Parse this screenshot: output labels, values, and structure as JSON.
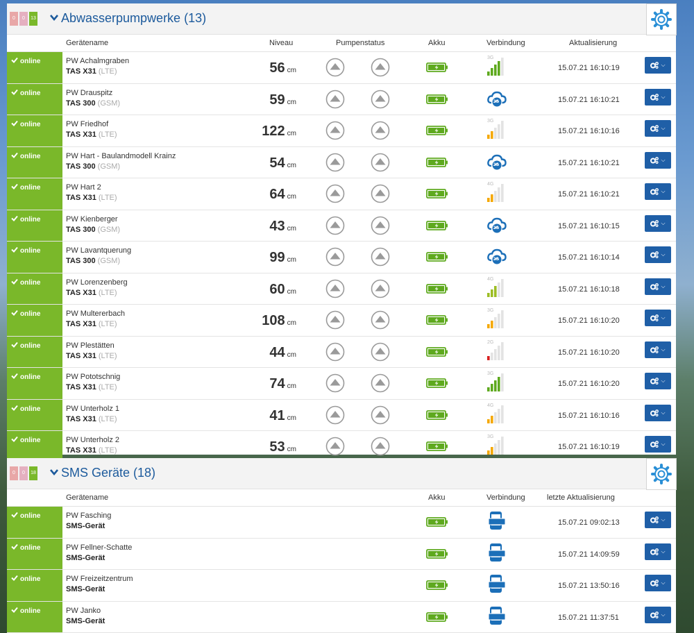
{
  "colors": {
    "online": "#7ab82a",
    "accent": "#1c5a9c",
    "button": "#1f5fa7",
    "gear": "#2a8fd6"
  },
  "panel1": {
    "badges": [
      "0",
      "0",
      "13"
    ],
    "title": "Abwasserpumpwerke (13)",
    "headers": {
      "name": "Gerätename",
      "niveau": "Niveau",
      "pump": "Pumpenstatus",
      "akku": "Akku",
      "conn": "Verbindung",
      "upd": "Aktualisierung"
    },
    "rows": [
      {
        "status": "online",
        "name": "PW Achalmgraben",
        "model": "TAS X31",
        "type": "(LTE)",
        "value": "56",
        "unit": "cm",
        "conn": "signal",
        "net": "3G",
        "bars": 4,
        "tone": "green",
        "updated": "15.07.21 16:10:19"
      },
      {
        "status": "online",
        "name": "PW Drauspitz",
        "model": "TAS 300",
        "type": "(GSM)",
        "value": "59",
        "unit": "cm",
        "conn": "cloud",
        "net": "2G",
        "updated": "15.07.21 16:10:21"
      },
      {
        "status": "online",
        "name": "PW Friedhof",
        "model": "TAS X31",
        "type": "(LTE)",
        "value": "122",
        "unit": "cm",
        "conn": "signal",
        "net": "3G",
        "bars": 2,
        "tone": "orange",
        "updated": "15.07.21 16:10:16"
      },
      {
        "status": "online",
        "name": "PW Hart - Baulandmodell Krainz",
        "model": "TAS 300",
        "type": "(GSM)",
        "value": "54",
        "unit": "cm",
        "conn": "cloud",
        "net": "2G",
        "updated": "15.07.21 16:10:21"
      },
      {
        "status": "online",
        "name": "PW Hart 2",
        "model": "TAS X31",
        "type": "(LTE)",
        "value": "64",
        "unit": "cm",
        "conn": "signal",
        "net": "4G",
        "bars": 2,
        "tone": "orange",
        "updated": "15.07.21 16:10:21"
      },
      {
        "status": "online",
        "name": "PW Kienberger",
        "model": "TAS 300",
        "type": "(GSM)",
        "value": "43",
        "unit": "cm",
        "conn": "cloud",
        "net": "2G",
        "updated": "15.07.21 16:10:15"
      },
      {
        "status": "online",
        "name": "PW Lavantquerung",
        "model": "TAS 300",
        "type": "(GSM)",
        "value": "99",
        "unit": "cm",
        "conn": "cloud",
        "net": "2G",
        "updated": "15.07.21 16:10:14"
      },
      {
        "status": "online",
        "name": "PW Lorenzenberg",
        "model": "TAS X31",
        "type": "(LTE)",
        "value": "60",
        "unit": "cm",
        "conn": "signal",
        "net": "4G",
        "bars": 3,
        "tone": "yellowgreen",
        "updated": "15.07.21 16:10:18"
      },
      {
        "status": "online",
        "name": "PW Multererbach",
        "model": "TAS X31",
        "type": "(LTE)",
        "value": "108",
        "unit": "cm",
        "conn": "signal",
        "net": "3G",
        "bars": 2,
        "tone": "orange",
        "updated": "15.07.21 16:10:20"
      },
      {
        "status": "online",
        "name": "PW Plestätten",
        "model": "TAS X31",
        "type": "(LTE)",
        "value": "44",
        "unit": "cm",
        "conn": "signal",
        "net": "2G",
        "bars": 1,
        "tone": "red",
        "updated": "15.07.21 16:10:20"
      },
      {
        "status": "online",
        "name": "PW Pototschnig",
        "model": "TAS X31",
        "type": "(LTE)",
        "value": "74",
        "unit": "cm",
        "conn": "signal",
        "net": "3G",
        "bars": 4,
        "tone": "green",
        "updated": "15.07.21 16:10:20"
      },
      {
        "status": "online",
        "name": "PW Unterholz 1",
        "model": "TAS X31",
        "type": "(LTE)",
        "value": "41",
        "unit": "cm",
        "conn": "signal",
        "net": "4G",
        "bars": 2,
        "tone": "orange",
        "updated": "15.07.21 16:10:16"
      },
      {
        "status": "online",
        "name": "PW Unterholz 2",
        "model": "TAS X31",
        "type": "(LTE)",
        "value": "53",
        "unit": "cm",
        "conn": "signal",
        "net": "3G",
        "bars": 2,
        "tone": "orange",
        "updated": "15.07.21 16:10:19"
      }
    ]
  },
  "panel2": {
    "badges": [
      "0",
      "0",
      "18"
    ],
    "title": "SMS Geräte (18)",
    "headers": {
      "name": "Gerätename",
      "akku": "Akku",
      "conn": "Verbindung",
      "upd": "letzte Aktualisierung"
    },
    "sms_label": "SMS",
    "rows": [
      {
        "status": "online",
        "name": "PW Fasching",
        "model": "SMS-Gerät",
        "updated": "15.07.21 09:02:13"
      },
      {
        "status": "online",
        "name": "PW Fellner-Schatte",
        "model": "SMS-Gerät",
        "updated": "15.07.21 14:09:59"
      },
      {
        "status": "online",
        "name": "PW Freizeitzentrum",
        "model": "SMS-Gerät",
        "updated": "15.07.21 13:50:16"
      },
      {
        "status": "online",
        "name": "PW Janko",
        "model": "SMS-Gerät",
        "updated": "15.07.21 11:37:51"
      }
    ]
  }
}
